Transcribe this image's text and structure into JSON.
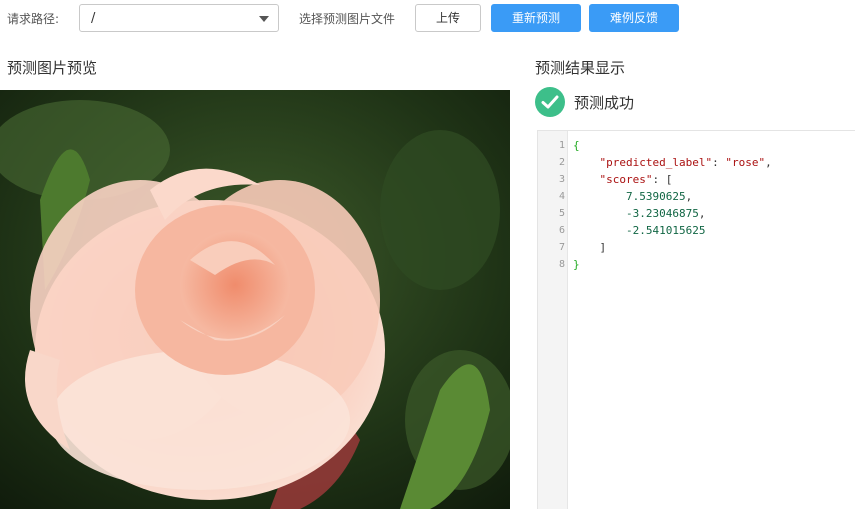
{
  "toolbar": {
    "path_label": "请求路径:",
    "path_value": "/",
    "file_label": "选择预测图片文件",
    "upload_label": "上传",
    "repredict_label": "重新预测",
    "feedback_label": "难例反馈"
  },
  "preview": {
    "title": "预测图片预览"
  },
  "result": {
    "title": "预测结果显示",
    "status": "预测成功",
    "lines": [
      {
        "n": "1",
        "parts": [
          [
            "br",
            "{"
          ]
        ]
      },
      {
        "n": "2",
        "parts": [
          [
            "p",
            "    "
          ],
          [
            "k",
            "\"predicted_label\""
          ],
          [
            "p",
            ": "
          ],
          [
            "s",
            "\"rose\""
          ],
          [
            "p",
            ","
          ]
        ]
      },
      {
        "n": "3",
        "parts": [
          [
            "p",
            "    "
          ],
          [
            "k",
            "\"scores\""
          ],
          [
            "p",
            ": ["
          ]
        ]
      },
      {
        "n": "4",
        "parts": [
          [
            "p",
            "        "
          ],
          [
            "n",
            "7.5390625"
          ],
          [
            "p",
            ","
          ]
        ]
      },
      {
        "n": "5",
        "parts": [
          [
            "p",
            "        "
          ],
          [
            "n",
            "-3.23046875"
          ],
          [
            "p",
            ","
          ]
        ]
      },
      {
        "n": "6",
        "parts": [
          [
            "p",
            "        "
          ],
          [
            "n",
            "-2.541015625"
          ]
        ]
      },
      {
        "n": "7",
        "parts": [
          [
            "p",
            "    ]"
          ]
        ]
      },
      {
        "n": "8",
        "parts": [
          [
            "br",
            "}"
          ]
        ]
      }
    ]
  },
  "colors": {
    "accent": "#3a9bf6",
    "success": "#3dbf8a"
  }
}
